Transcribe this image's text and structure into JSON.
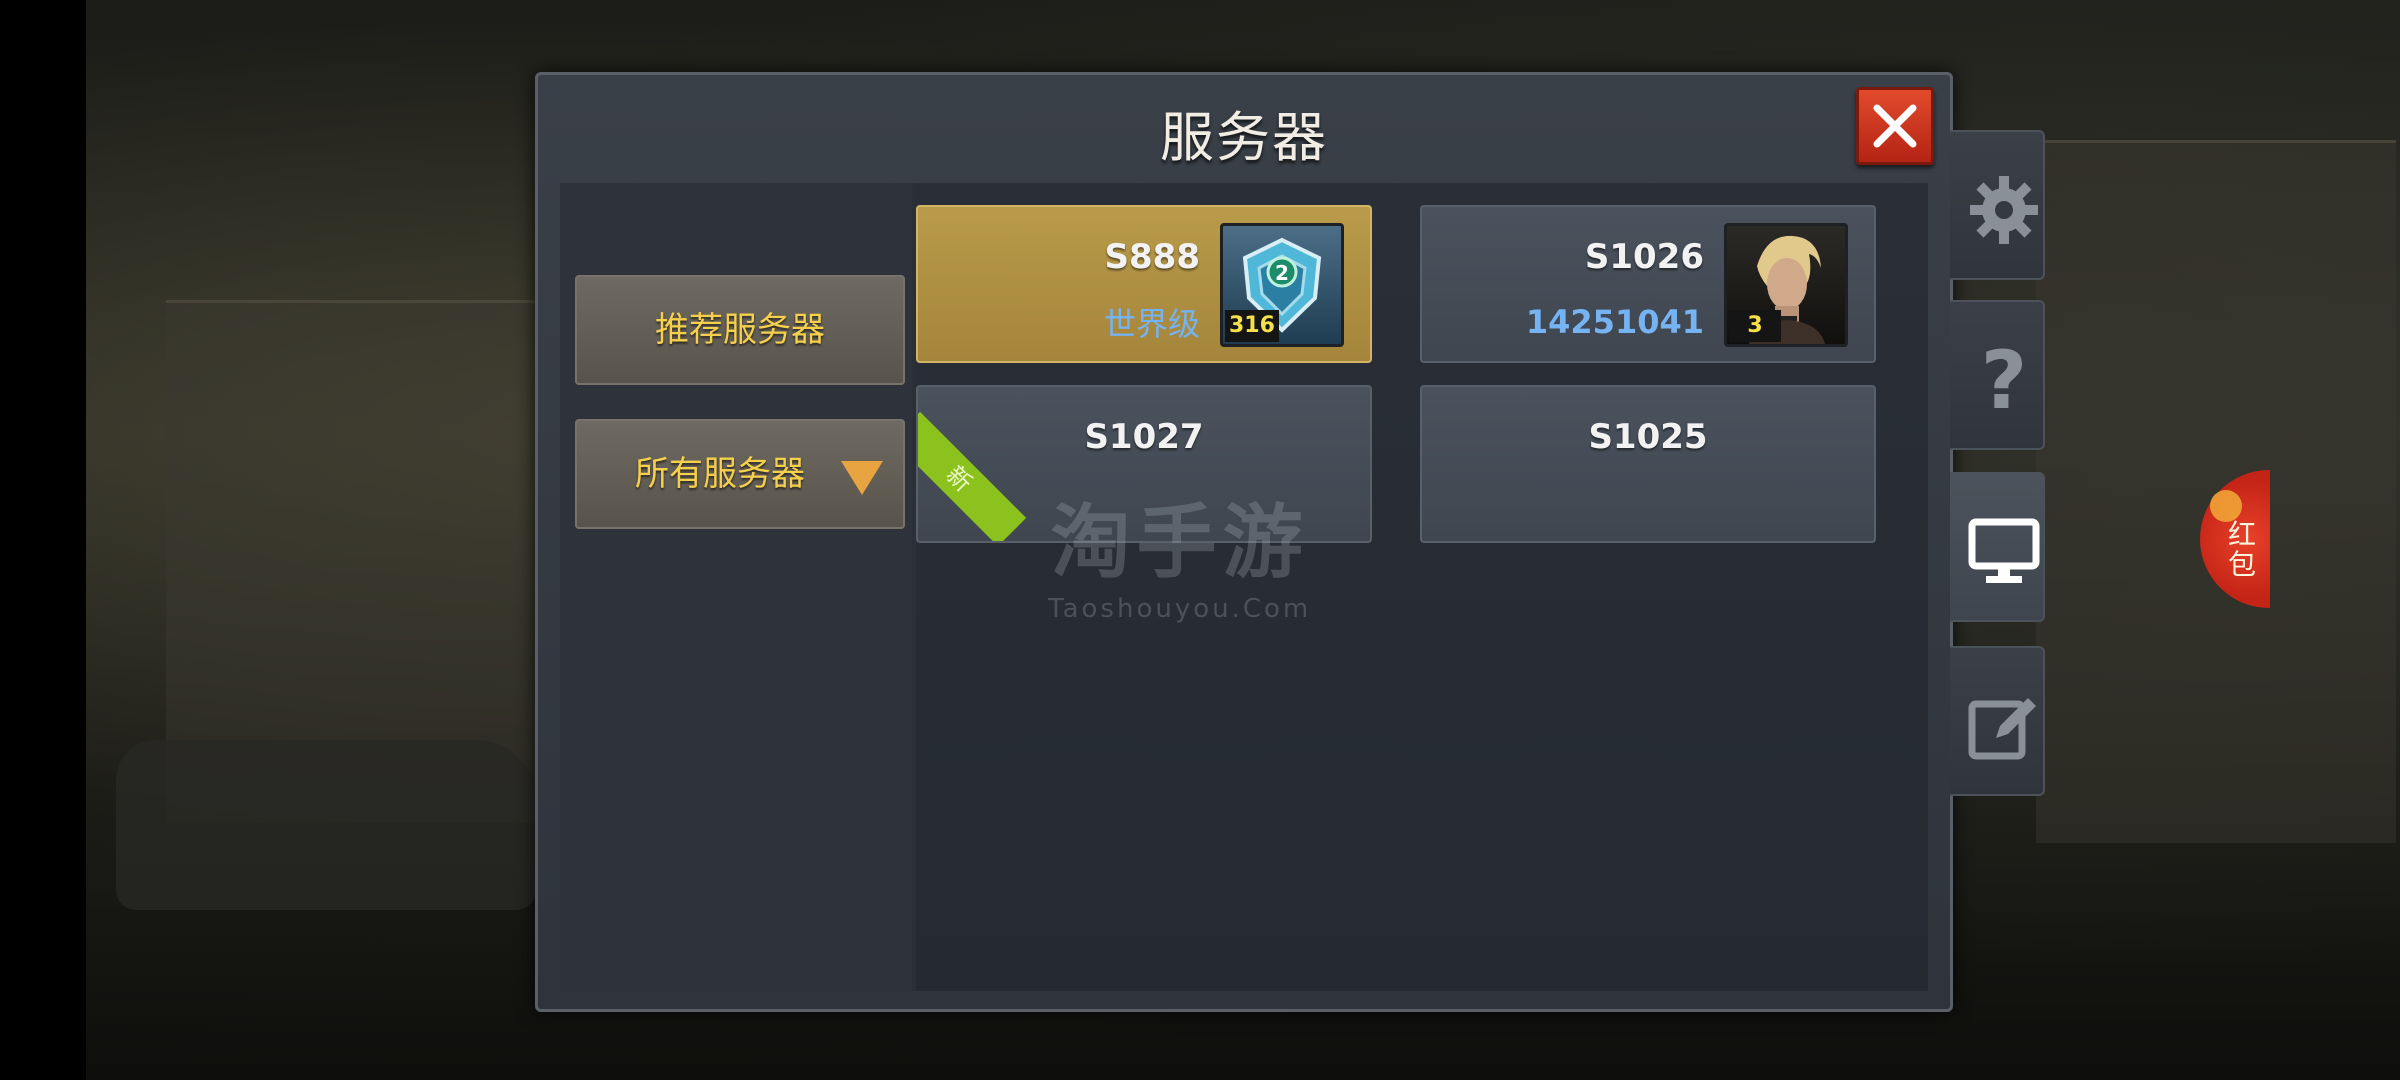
{
  "dialog": {
    "title": "服务器",
    "close_icon": "close-icon"
  },
  "tabs": [
    {
      "label": "推荐服务器",
      "selected": false
    },
    {
      "label": "所有服务器",
      "has_dropdown": true
    }
  ],
  "servers": [
    {
      "name": "S888",
      "subtitle": "世界级",
      "level": "316",
      "avatar": "emblem-badge",
      "selected": true,
      "emblem_number": "2"
    },
    {
      "name": "S1026",
      "subtitle": "14251041",
      "level": "3",
      "avatar": "character-portrait",
      "selected": false
    },
    {
      "name": "S1027",
      "tag": "新",
      "selected": false
    },
    {
      "name": "S1025",
      "selected": false
    }
  ],
  "watermark": {
    "main": "淘手游",
    "sub": "Taoshouyou.Com"
  },
  "side_tabs": [
    {
      "icon": "gear-icon"
    },
    {
      "icon": "help-icon"
    },
    {
      "icon": "monitor-icon",
      "active": true
    },
    {
      "icon": "edit-icon"
    }
  ],
  "red_packet": {
    "label": "红包"
  },
  "colors": {
    "accent_gold": "#f6d04a",
    "selected_card": "#b99b4b",
    "subtitle_blue": "#76b3f2",
    "close_red": "#e24a2b",
    "new_ribbon": "#8cc21d"
  }
}
